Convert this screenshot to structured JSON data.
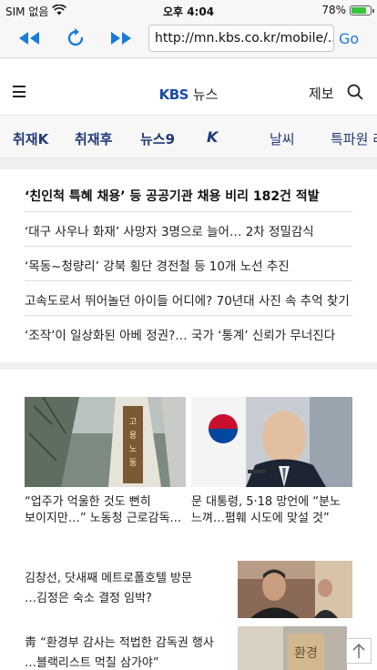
{
  "status_bar": {
    "carrier": "SIM 없음",
    "time": "오후 4:04",
    "battery_text": "78%",
    "battery_level": 0.78,
    "icons": [
      "wifi-icon",
      "battery-icon"
    ]
  },
  "browser": {
    "back_icon": "double-left-arrow-icon",
    "reload_icon": "reload-icon",
    "forward_icon": "double-right-arrow-icon",
    "url": "http://mn.kbs.co.kr/mobile/...",
    "go_label": "Go",
    "accent": "#1a7bdc"
  },
  "header": {
    "menu_icon": "hamburger-menu-icon",
    "logo_kbs": "KBS",
    "logo_news": "뉴스",
    "report_label": "제보",
    "search_icon": "search-icon"
  },
  "tabs": [
    "취재K",
    "취재후",
    "뉴스9",
    "K",
    "날씨",
    "특파원 리"
  ],
  "headlines": [
    "‘친인척 특혜 채용’ 등 공공기관 채용 비리 182건 적발",
    "‘대구 사우나 화재’ 사망자 3명으로 늘어… 2차 정밀감식",
    "‘목동~청량리’ 강북 횡단 경전철 등 10개 노선 추진",
    "고속도로서 뛰어놀던 아이들 어디에? 70년대 사진 속 추억 찾기",
    "‘조작’이 일상화된 아베 정권?… 국가 ‘통계’ 신뢰가 무너진다"
  ],
  "photo_cards": [
    {
      "line1": "“업주가 억울한 것도 뻔히",
      "line2": "보이지만…” 노동청 근로감독..."
    },
    {
      "line1": "문 대통령, 5·18 망언에 “분노",
      "line2": "느껴…폄훼 시도에 맞설 것”"
    }
  ],
  "news_items": [
    {
      "line1": "김창선, 닷새째 메트로폴호텔 방문",
      "line2": "…김정은 숙소 결정 임박?"
    },
    {
      "line1": "靑 “환경부 감사는 적법한 감독권 행사",
      "line2": "…블랙리스트 먹칠 삼가야”"
    }
  ],
  "scroll_top_icon": "scroll-to-top-icon"
}
